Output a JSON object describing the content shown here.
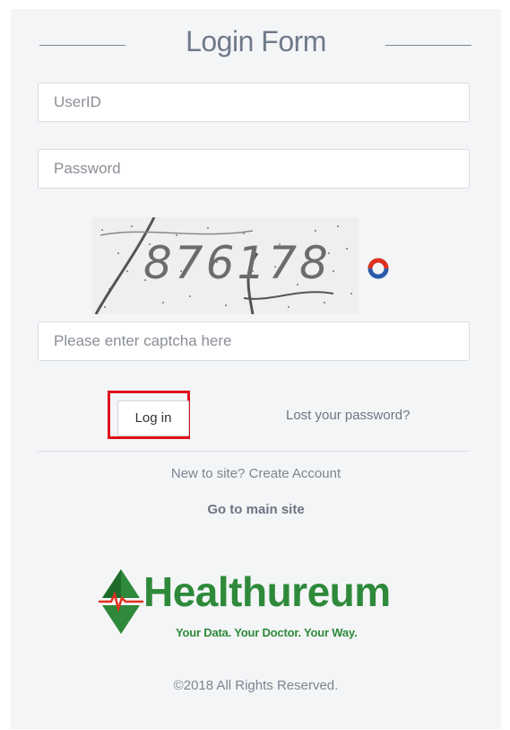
{
  "form": {
    "title": "Login Form",
    "userid_placeholder": "UserID",
    "password_placeholder": "Password",
    "captcha_text": "876178",
    "captcha_placeholder": "Please enter captcha here",
    "login_label": "Log in",
    "lost_password_label": "Lost your password?",
    "new_to_site": "New to site? Create Account",
    "main_site": "Go to main site"
  },
  "logo": {
    "name": "Healthureum",
    "tagline": "Your Data. Your Doctor. Your Way."
  },
  "footer": {
    "copyright": "©2018 All Rights Reserved."
  },
  "colors": {
    "brand_green": "#2e8a3a",
    "highlight_red": "#e0101a",
    "refresh_blue": "#2a5aa8",
    "refresh_red": "#e0301e"
  },
  "icons": {
    "refresh": "refresh-captcha-icon",
    "logo_mark": "healthureum-diamond-icon"
  }
}
